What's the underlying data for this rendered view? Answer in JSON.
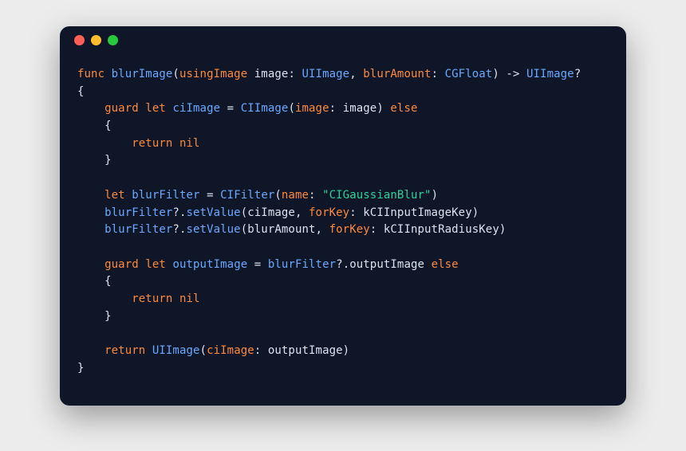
{
  "window": {
    "buttons": {
      "close": "close",
      "minimize": "minimize",
      "zoom": "zoom"
    }
  },
  "code": {
    "kw_func": "func",
    "fn_name": "blurImage",
    "lparen": "(",
    "param1_ext": "usingImage",
    "param1_int": "image",
    "colon": ":",
    "type_uiimage": "UIImage",
    "comma": ",",
    "param2": "blurAmount",
    "type_cgfloat": "CGFloat",
    "rparen": ")",
    "arrow": "->",
    "ret_type": "UIImage",
    "qmark": "?",
    "lbrace": "{",
    "rbrace": "}",
    "kw_guard": "guard",
    "kw_let": "let",
    "var_ciimage": "ciImage",
    "eq": "=",
    "type_ciimage": "CIImage",
    "arg_image_lab": "image",
    "arg_image_val": "image",
    "kw_else": "else",
    "kw_return": "return",
    "nil": "nil",
    "var_blurfilter": "blurFilter",
    "type_cifilter": "CIFilter",
    "arg_name_lab": "name",
    "str_gauss": "\"CIGaussianBlur\"",
    "dot": ".",
    "m_setvalue": "setValue",
    "arg_forkey": "forKey",
    "const_inputimg": "kCIInputImageKey",
    "arg_bluramount": "blurAmount",
    "const_inputrad": "kCIInputRadiusKey",
    "var_outputimage": "outputImage",
    "prop_outputimage": "outputImage",
    "type_uiimage2": "UIImage",
    "arg_ciimage_lab": "ciImage",
    "arg_outputimage": "outputImage"
  }
}
